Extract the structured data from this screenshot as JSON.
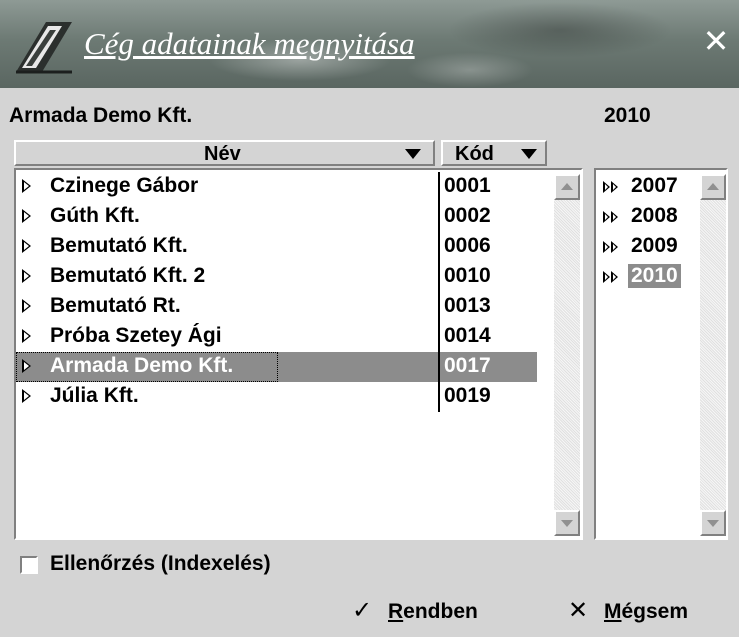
{
  "window": {
    "title": "Cég adatainak megnyitása",
    "close_glyph": "✕",
    "logo_icon": "book-logo-icon"
  },
  "selected_company": "Armada Demo Kft.",
  "selected_year": "2010",
  "columns": {
    "name": "Név",
    "code": "Kód"
  },
  "companies": [
    {
      "name": "Czinege Gábor",
      "code": "0001"
    },
    {
      "name": "Gúth Kft.",
      "code": "0002"
    },
    {
      "name": "Bemutató Kft.",
      "code": "0006"
    },
    {
      "name": "Bemutató Kft. 2",
      "code": "0010"
    },
    {
      "name": "Bemutató Rt.",
      "code": "0013"
    },
    {
      "name": "Próba Szetey Ági",
      "code": "0014"
    },
    {
      "name": "Armada Demo Kft.",
      "code": "0017"
    },
    {
      "name": "Júlia Kft.",
      "code": "0019"
    }
  ],
  "selected_company_index": 6,
  "years": [
    "2007",
    "2008",
    "2009",
    "2010"
  ],
  "selected_year_index": 3,
  "check": {
    "label": "Ellenőrzés (Indexelés)",
    "checked": false
  },
  "buttons": {
    "ok": {
      "label_first": "R",
      "label_rest": "endben",
      "icon": "checkmark-icon"
    },
    "cancel": {
      "label_first": "M",
      "label_rest": "égsem",
      "icon": "x-icon"
    }
  },
  "colors": {
    "selection": "#8c8c8c",
    "dialog_bg": "#d4d4d4"
  }
}
